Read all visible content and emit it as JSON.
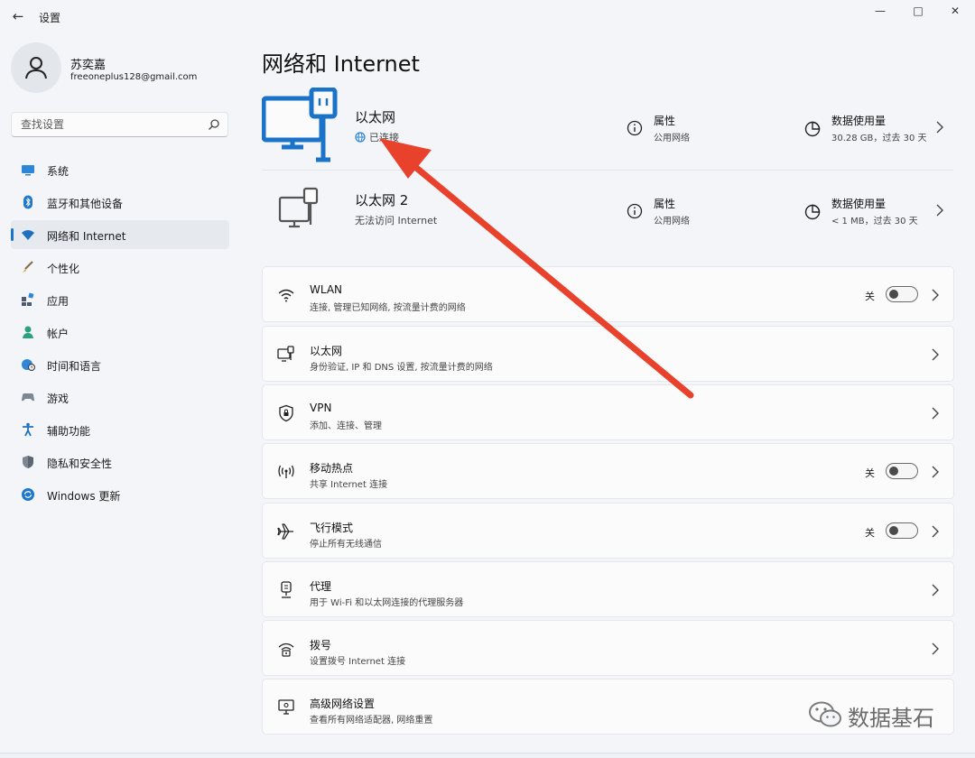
{
  "window": {
    "app_title": "设置",
    "minimize_glyph": "—",
    "maximize_glyph": "□",
    "close_glyph": "✕",
    "back_glyph": "←"
  },
  "profile": {
    "name": "苏奕嘉",
    "email": "freeoneplus128@gmail.com"
  },
  "search": {
    "placeholder": "查找设置"
  },
  "sidebar": {
    "items": [
      {
        "label": "系统",
        "icon": "monitor-icon"
      },
      {
        "label": "蓝牙和其他设备",
        "icon": "bluetooth-icon"
      },
      {
        "label": "网络和 Internet",
        "icon": "wifi-icon",
        "active": true
      },
      {
        "label": "个性化",
        "icon": "brush-icon"
      },
      {
        "label": "应用",
        "icon": "apps-icon"
      },
      {
        "label": "帐户",
        "icon": "person-icon"
      },
      {
        "label": "时间和语言",
        "icon": "globe-clock-icon"
      },
      {
        "label": "游戏",
        "icon": "gamepad-icon"
      },
      {
        "label": "辅助功能",
        "icon": "accessibility-icon"
      },
      {
        "label": "隐私和安全性",
        "icon": "shield-icon"
      },
      {
        "label": "Windows 更新",
        "icon": "update-icon"
      }
    ]
  },
  "main": {
    "title": "网络和 Internet",
    "ethernet": [
      {
        "name": "以太网",
        "status": "已连接",
        "prop_title": "属性",
        "prop_sub": "公用网络",
        "data_title": "数据使用量",
        "data_sub": "30.28 GB，过去 30 天"
      },
      {
        "name": "以太网 2",
        "status": "无法访问 Internet",
        "prop_title": "属性",
        "prop_sub": "公用网络",
        "data_title": "数据使用量",
        "data_sub": "< 1 MB，过去 30 天"
      }
    ],
    "cards": [
      {
        "title": "WLAN",
        "sub": "连接, 管理已知网络, 按流量计费的网络",
        "state": "关",
        "icon": "wifi-icon"
      },
      {
        "title": "以太网",
        "sub": "身份验证, IP 和 DNS 设置, 按流量计费的网络",
        "icon": "ethernet-icon"
      },
      {
        "title": "VPN",
        "sub": "添加、连接、管理",
        "icon": "vpn-shield-icon"
      },
      {
        "title": "移动热点",
        "sub": "共享 Internet 连接",
        "state": "关",
        "icon": "hotspot-icon"
      },
      {
        "title": "飞行模式",
        "sub": "停止所有无线通信",
        "state": "关",
        "icon": "airplane-icon"
      },
      {
        "title": "代理",
        "sub": "用于 Wi-Fi 和以太网连接的代理服务器",
        "icon": "proxy-icon"
      },
      {
        "title": "拨号",
        "sub": "设置拨号 Internet 连接",
        "icon": "dialup-icon"
      },
      {
        "title": "高级网络设置",
        "sub": "查看所有网络适配器, 网络重置",
        "icon": "advanced-network-icon"
      }
    ]
  },
  "watermark": {
    "text": "数据基石"
  },
  "colors": {
    "accent": "#1a73c9",
    "annotation_arrow": "#e8412c",
    "background": "#f3f5f9",
    "card": "#fbfbfc"
  }
}
